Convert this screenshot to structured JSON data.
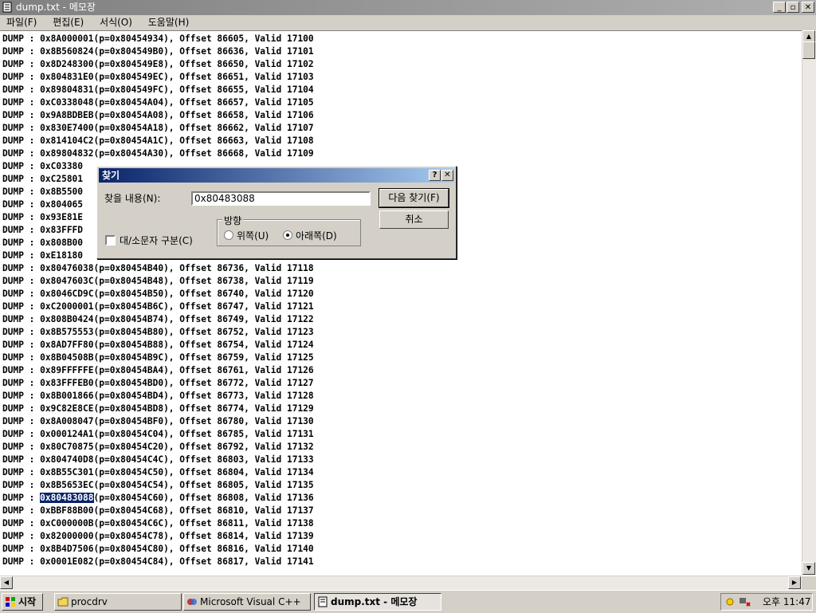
{
  "window": {
    "title": "dump.txt - 메모장",
    "controls": [
      "_",
      "▫",
      "✕"
    ]
  },
  "menu": [
    "파일(F)",
    "편집(E)",
    "서식(O)",
    "도움말(H)"
  ],
  "editor": {
    "lines": [
      "DUMP : 0x8A000001(p=0x80454934), Offset 86605, Valid 17100",
      "DUMP : 0x8B560824(p=0x804549B0), Offset 86636, Valid 17101",
      "DUMP : 0x8D248300(p=0x804549E8), Offset 86650, Valid 17102",
      "DUMP : 0x804831E0(p=0x804549EC), Offset 86651, Valid 17103",
      "DUMP : 0x89804831(p=0x804549FC), Offset 86655, Valid 17104",
      "DUMP : 0xC0338048(p=0x80454A04), Offset 86657, Valid 17105",
      "DUMP : 0x9A8BDBEB(p=0x80454A08), Offset 86658, Valid 17106",
      "DUMP : 0x830E7400(p=0x80454A18), Offset 86662, Valid 17107",
      "DUMP : 0x814104C2(p=0x80454A1C), Offset 86663, Valid 17108",
      "DUMP : 0x89804832(p=0x80454A30), Offset 86668, Valid 17109",
      "DUMP : 0xC03380",
      "DUMP : 0xC25801",
      "DUMP : 0x8B5500",
      "DUMP : 0x804065",
      "DUMP : 0x93E81E",
      "DUMP : 0x83FFFD",
      "DUMP : 0x808B00",
      "DUMP : 0xE18180",
      "DUMP : 0x80476038(p=0x80454B40), Offset 86736, Valid 17118",
      "DUMP : 0x8047603C(p=0x80454B48), Offset 86738, Valid 17119",
      "DUMP : 0x8046CD9C(p=0x80454B50), Offset 86740, Valid 17120",
      "DUMP : 0xC2000001(p=0x80454B6C), Offset 86747, Valid 17121",
      "DUMP : 0x808B0424(p=0x80454B74), Offset 86749, Valid 17122",
      "DUMP : 0x8B575553(p=0x80454B80), Offset 86752, Valid 17123",
      "DUMP : 0x8AD7FF80(p=0x80454B88), Offset 86754, Valid 17124",
      "DUMP : 0x8B04508B(p=0x80454B9C), Offset 86759, Valid 17125",
      "DUMP : 0x89FFFFFE(p=0x80454BA4), Offset 86761, Valid 17126",
      "DUMP : 0x83FFFEB0(p=0x80454BD0), Offset 86772, Valid 17127",
      "DUMP : 0x8B001866(p=0x80454BD4), Offset 86773, Valid 17128",
      "DUMP : 0x9C82E8CE(p=0x80454BD8), Offset 86774, Valid 17129",
      "DUMP : 0x8A008047(p=0x80454BF0), Offset 86780, Valid 17130",
      "DUMP : 0x000124A1(p=0x80454C04), Offset 86785, Valid 17131",
      "DUMP : 0x80C70875(p=0x80454C20), Offset 86792, Valid 17132",
      "DUMP : 0x804740D8(p=0x80454C4C), Offset 86803, Valid 17133",
      "DUMP : 0x8B55C301(p=0x80454C50), Offset 86804, Valid 17134",
      "DUMP : 0x8B5653EC(p=0x80454C54), Offset 86805, Valid 17135",
      "DUMP : 0x80483088(p=0x80454C60), Offset 86808, Valid 17136",
      "DUMP : 0xBBF88B00(p=0x80454C68), Offset 86810, Valid 17137",
      "DUMP : 0xC000000B(p=0x80454C6C), Offset 86811, Valid 17138",
      "DUMP : 0x82000000(p=0x80454C78), Offset 86814, Valid 17139",
      "DUMP : 0x8B4D7506(p=0x80454C80), Offset 86816, Valid 17140",
      "DUMP : 0x0001E082(p=0x80454C84), Offset 86817, Valid 17141"
    ],
    "highlighted_line": 36,
    "highlight_text": "0x80483088",
    "highlight_prefix": "DUMP : ",
    "highlight_suffix": "(p=0x80454C60), Offset 86808, Valid 17136"
  },
  "find_dialog": {
    "title": "찾기",
    "help_button": "?",
    "close_button": "✕",
    "find_label": "찾을 내용(N):",
    "find_value": "0x80483088",
    "find_next_button": "다음 찾기(F)",
    "cancel_button": "취소",
    "match_case_label": "대/소문자 구분(C)",
    "match_case_checked": false,
    "direction_label": "방향",
    "direction_up_label": "위쪽(U)",
    "direction_down_label": "아래쪽(D)",
    "direction_selected": "down"
  },
  "taskbar": {
    "start_label": "시작",
    "buttons": [
      {
        "label": "procdrv",
        "active": false
      },
      {
        "label": "Microsoft Visual C++",
        "active": false
      },
      {
        "label": "dump.txt - 메모장",
        "active": true
      }
    ],
    "clock": "오후 11:47"
  },
  "colors": {
    "highlight": "#0a246a",
    "dialog_title_start": "#0a246a",
    "dialog_title_end": "#a6caf0"
  }
}
